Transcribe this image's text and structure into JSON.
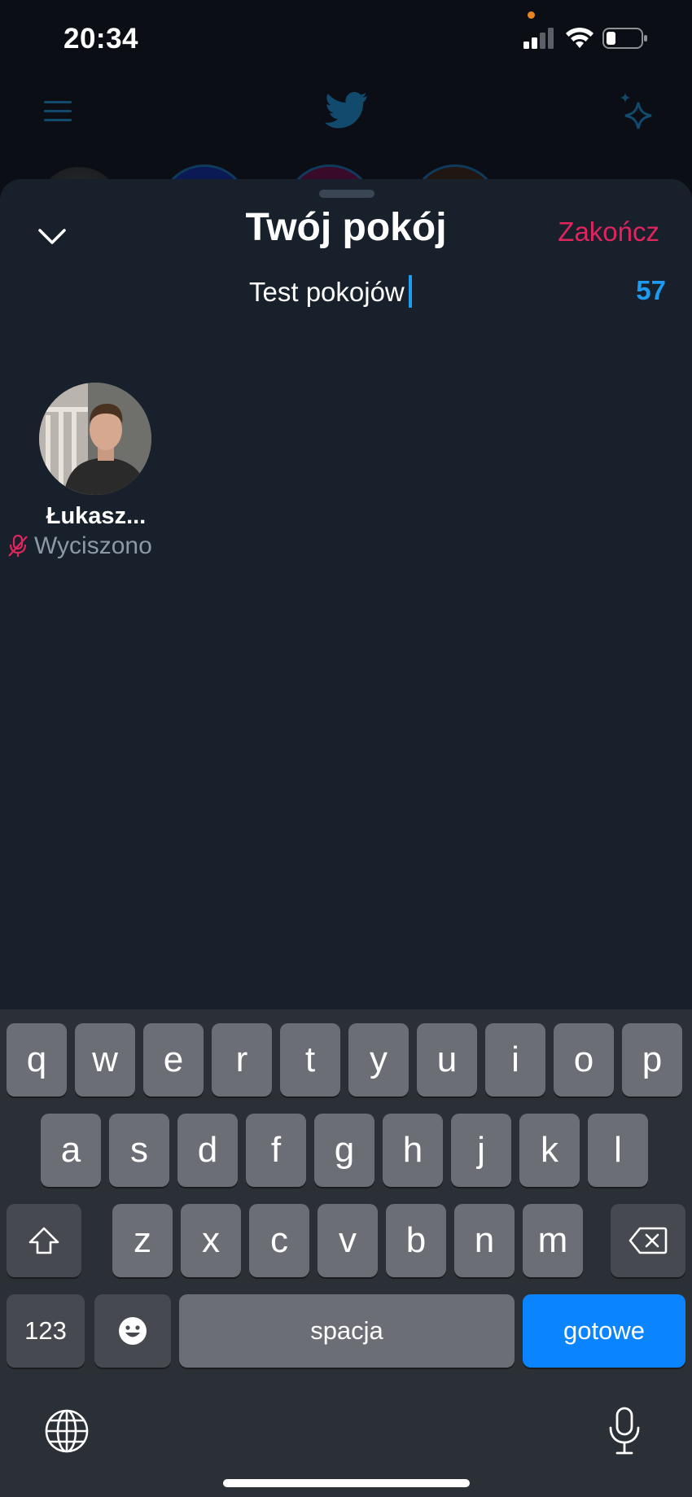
{
  "status_bar": {
    "time": "20:34"
  },
  "sheet": {
    "title": "Twój pokój",
    "end_label": "Zakończ",
    "topic_value": "Test pokojów",
    "char_count": "57"
  },
  "speakers": [
    {
      "name": "Łukasz...",
      "status": "Wyciszono"
    }
  ],
  "keyboard": {
    "row1": [
      "q",
      "w",
      "e",
      "r",
      "t",
      "y",
      "u",
      "i",
      "o",
      "p"
    ],
    "row2": [
      "a",
      "s",
      "d",
      "f",
      "g",
      "h",
      "j",
      "k",
      "l"
    ],
    "row3": [
      "z",
      "x",
      "c",
      "v",
      "b",
      "n",
      "m"
    ],
    "numbers_label": "123",
    "space_label": "spacja",
    "done_label": "gotowe"
  },
  "colors": {
    "accent_blue": "#1d9bf0",
    "end_red": "#e0245e",
    "done_blue": "#0a84ff",
    "sheet_bg": "#18202b"
  },
  "icons": [
    "menu-icon",
    "twitter-bird-icon",
    "sparkle-icon",
    "chevron-down-icon",
    "mic-off-icon",
    "shift-icon",
    "backspace-icon",
    "emoji-icon",
    "globe-icon",
    "microphone-icon"
  ]
}
